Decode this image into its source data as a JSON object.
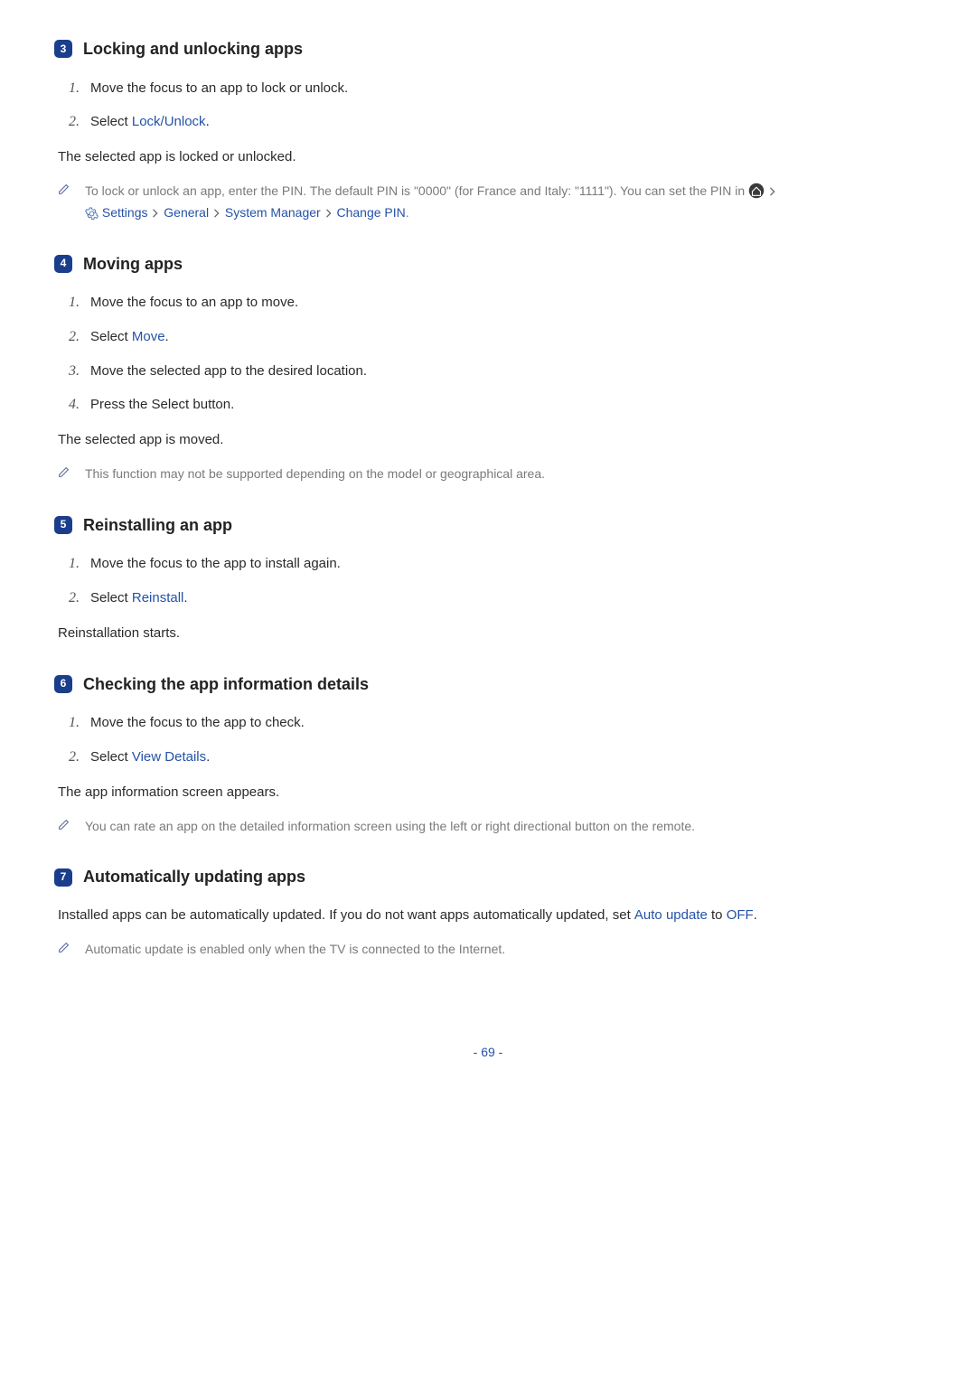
{
  "sections": [
    {
      "badge": "3",
      "title": "Locking and unlocking apps",
      "steps": [
        {
          "num": "1.",
          "parts": [
            "Move the focus to an app to lock or unlock."
          ]
        },
        {
          "num": "2.",
          "parts": [
            "Select ",
            {
              "link": "Lock/Unlock"
            },
            "."
          ]
        }
      ],
      "plain": "The selected app is locked or unlocked.",
      "notes": [
        {
          "type": "pin",
          "pre": "To lock or unlock an app, enter the PIN. The default PIN is \"0000\" (for France and Italy: \"1111\"). You can set the PIN in ",
          "path": [
            "Settings",
            "General",
            "System Manager",
            "Change PIN"
          ]
        }
      ]
    },
    {
      "badge": "4",
      "title": "Moving apps",
      "steps": [
        {
          "num": "1.",
          "parts": [
            "Move the focus to an app to move."
          ]
        },
        {
          "num": "2.",
          "parts": [
            "Select ",
            {
              "link": "Move"
            },
            "."
          ]
        },
        {
          "num": "3.",
          "parts": [
            "Move the selected app to the desired location."
          ]
        },
        {
          "num": "4.",
          "parts": [
            "Press the Select button."
          ]
        }
      ],
      "plain": "The selected app is moved.",
      "notes": [
        {
          "type": "simple",
          "text": "This function may not be supported depending on the model or geographical area."
        }
      ]
    },
    {
      "badge": "5",
      "title": "Reinstalling an app",
      "steps": [
        {
          "num": "1.",
          "parts": [
            "Move the focus to the app to install again."
          ]
        },
        {
          "num": "2.",
          "parts": [
            "Select ",
            {
              "link": "Reinstall"
            },
            "."
          ]
        }
      ],
      "plain": "Reinstallation starts."
    },
    {
      "badge": "6",
      "title": "Checking the app information details",
      "steps": [
        {
          "num": "1.",
          "parts": [
            "Move the focus to the app to check."
          ]
        },
        {
          "num": "2.",
          "parts": [
            "Select ",
            {
              "link": "View Details"
            },
            "."
          ]
        }
      ],
      "plain": "The app information screen appears.",
      "notes": [
        {
          "type": "simple",
          "text": "You can rate an app on the detailed information screen using the left or right directional button on the remote."
        }
      ]
    },
    {
      "badge": "7",
      "title": "Automatically updating apps",
      "plain_inline": {
        "pre": "Installed apps can be automatically updated. If you do not want apps automatically updated, set ",
        "link1": "Auto update",
        "mid": " to ",
        "link2": "OFF",
        "post": "."
      },
      "notes": [
        {
          "type": "simple",
          "text": "Automatic update is enabled only when the TV is connected to the Internet."
        }
      ]
    }
  ],
  "page_number": "- 69 -"
}
